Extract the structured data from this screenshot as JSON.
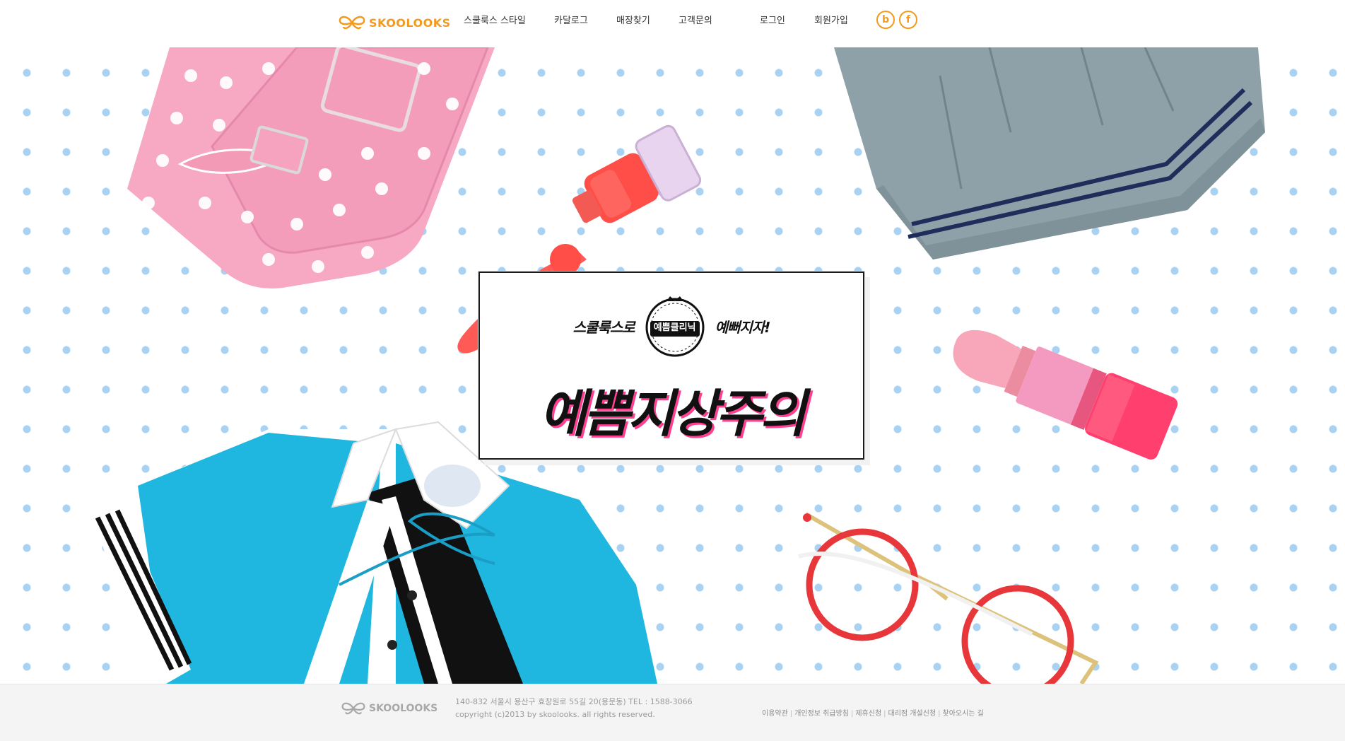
{
  "header": {
    "brand": "SKOOLOOKS",
    "nav": [
      "스쿨룩스 스타일",
      "카달로그",
      "매장찾기",
      "고객문의"
    ],
    "login": "로그인",
    "signup": "회원가입",
    "social": [
      {
        "icon": "blog-icon",
        "glyph": "b"
      },
      {
        "icon": "facebook-icon",
        "glyph": "f"
      }
    ],
    "accent_color": "#f39a1e"
  },
  "promo": {
    "left_text": "스쿨룩스로",
    "emblem_text": "예쁨클리닉",
    "right_text": "예뻐지자!",
    "title": "예쁨지상주의"
  },
  "footer": {
    "brand": "SKOOLOOKS",
    "address": "140-832 서울시 용산구 효창원로 55길 20(용문동) TEL : 1588-3066",
    "copyright": "copyright (c)2013 by skoolooks. all rights reserved.",
    "links": [
      "이용약관",
      "개인정보 취급방침",
      "제휴신청",
      "대리점 개설신청",
      "찾아오시는 길"
    ]
  },
  "colors": {
    "dots": "#a9d2f2",
    "title_shadow": "#ff3f8f"
  }
}
